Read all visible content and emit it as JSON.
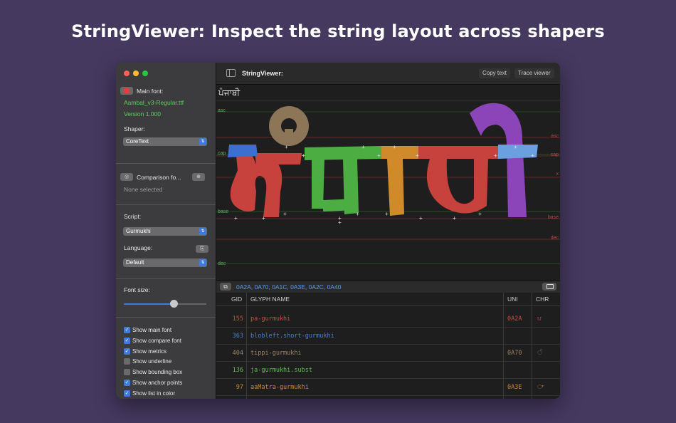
{
  "headline": "StringViewer: Inspect the string layout across shapers",
  "colors": {
    "accent": "#3e7bdc",
    "green_text": "#5fcf5f",
    "guide": "#7b2a2a"
  },
  "sidebar": {
    "main_font_label": "Main font:",
    "font_file": "Aambal_v3-Regular.ttf",
    "font_version": "Version 1.000",
    "shaper_label": "Shaper:",
    "shaper_value": "CoreText",
    "compare_label": "Comparison fo...",
    "compare_none": "None selected",
    "script_label": "Script:",
    "script_value": "Gurmukhi",
    "language_label": "Language:",
    "language_value": "Default",
    "fontsize_label": "Font size:",
    "fontsize_value": 0.6,
    "options": [
      {
        "label": "Show main font",
        "checked": true
      },
      {
        "label": "Show compare font",
        "checked": true
      },
      {
        "label": "Show metrics",
        "checked": true
      },
      {
        "label": "Show underline",
        "checked": false
      },
      {
        "label": "Show bounding box",
        "checked": false
      },
      {
        "label": "Show anchor points",
        "checked": true
      },
      {
        "label": "Show list in color",
        "checked": true
      }
    ]
  },
  "toolbar": {
    "title": "StringViewer:",
    "copy_text": "Copy text",
    "trace_viewer": "Trace viewer"
  },
  "canvas": {
    "input_text": "ਪੰਜਾਬੀ",
    "left_labels": [
      "asc",
      "cap",
      "base",
      "dec"
    ],
    "right_labels": [
      "asc",
      "cap",
      "x",
      "base",
      "dec"
    ]
  },
  "codepoints": "0A2A, 0A70, 0A1C, 0A3E, 0A2C, 0A40",
  "table": {
    "headers": {
      "gid": "GID",
      "name": "GLYPH NAME",
      "uni": "UNI",
      "chr": "CHR"
    },
    "rows": [
      {
        "gid": "155",
        "name": "pa-gurmukhi",
        "uni": "0A2A",
        "chr": "ਪ",
        "color": "#d04a45"
      },
      {
        "gid": "363",
        "name": "blobleft.short-gurmukhi",
        "uni": "",
        "chr": "",
        "color": "#4a7fd6"
      },
      {
        "gid": "404",
        "name": "tippi-gurmukhi",
        "uni": "0A70",
        "chr": "ੰ",
        "color": "#9a8468"
      },
      {
        "gid": "136",
        "name": "ja-gurmukhi.subst",
        "uni": "",
        "chr": "",
        "color": "#5fbf4f"
      },
      {
        "gid": "97",
        "name": "aaMatra-gurmukhi",
        "uni": "0A3E",
        "chr": "ਾ",
        "color": "#d08a2a"
      }
    ]
  }
}
